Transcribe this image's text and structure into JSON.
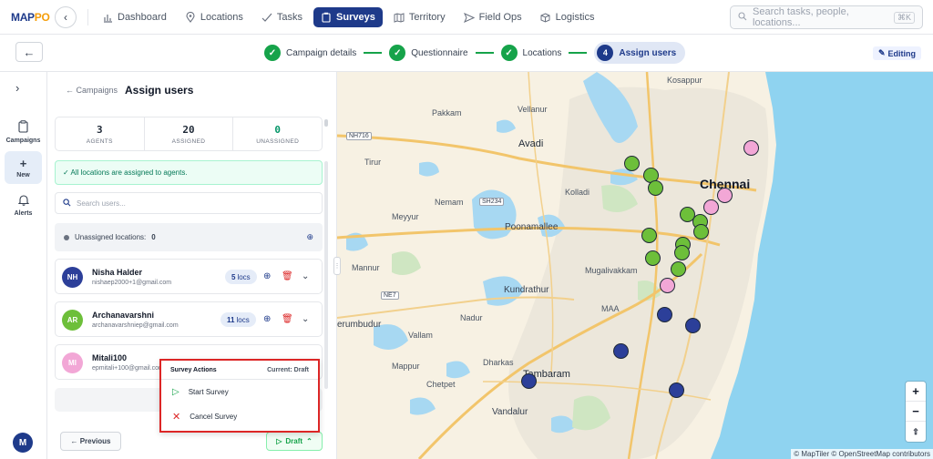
{
  "app": {
    "logo_main": "MAP",
    "logo_accent": "PO"
  },
  "nav": {
    "items": [
      {
        "label": "Dashboard",
        "icon": "bar-chart-icon"
      },
      {
        "label": "Locations",
        "icon": "pin-icon"
      },
      {
        "label": "Tasks",
        "icon": "check-icon"
      },
      {
        "label": "Surveys",
        "icon": "clipboard-icon",
        "active": true
      },
      {
        "label": "Territory",
        "icon": "map-icon"
      },
      {
        "label": "Field Ops",
        "icon": "send-icon"
      },
      {
        "label": "Logistics",
        "icon": "box-icon"
      }
    ],
    "search_placeholder": "Search tasks, people, locations...",
    "search_shortcut": "⌘K"
  },
  "stepper": {
    "steps": [
      {
        "num": "1",
        "label": "Campaign details",
        "done": true
      },
      {
        "num": "2",
        "label": "Questionnaire",
        "done": true
      },
      {
        "num": "3",
        "label": "Locations",
        "done": true
      },
      {
        "num": "4",
        "label": "Assign users",
        "done": false
      }
    ],
    "editing_label": "Editing"
  },
  "rail": {
    "items": [
      {
        "label": "Campaigns"
      },
      {
        "label": "New"
      },
      {
        "label": "Alerts"
      }
    ],
    "user_initial": "M"
  },
  "panel": {
    "crumb": "← Campaigns",
    "title": "Assign users",
    "stats": [
      {
        "value": "3",
        "label": "AGENTS"
      },
      {
        "value": "20",
        "label": "ASSIGNED"
      },
      {
        "value": "0",
        "label": "UNASSIGNED"
      }
    ],
    "alert": "✓ All locations are assigned to agents.",
    "search_placeholder": "Search users...",
    "unassigned_label": "Unassigned locations:",
    "unassigned_count": "0",
    "agents": [
      {
        "initials": "NH",
        "name": "Nisha Halder",
        "email": "nishaep2000+1@gmail.com",
        "locs_num": "5",
        "locs_unit": "locs",
        "color": "#2c3f99"
      },
      {
        "initials": "AR",
        "name": "Archanavarshni",
        "email": "archanavarshniep@gmail.com",
        "locs_num": "11",
        "locs_unit": "locs",
        "color": "#6dbf3a"
      },
      {
        "initials": "MI",
        "name": "Mitali100",
        "email": "epmitali+100@gmail.com",
        "color": "#f2a7d6"
      }
    ],
    "previous_label": "← Previous",
    "draft_label": "Draft"
  },
  "popup": {
    "title": "Survey Actions",
    "current": "Current: Draft",
    "items": [
      {
        "label": "Start Survey",
        "icon": "play-icon"
      },
      {
        "label": "Cancel Survey",
        "icon": "x-icon"
      }
    ]
  },
  "map": {
    "labels": {
      "kosappur": "Kosappur",
      "pakkam": "Pakkam",
      "vellanur": "Vellanur",
      "avadi": "Avadi",
      "tirur": "Tirur",
      "chennai": "Chennai",
      "nemam": "Nemam",
      "kolladi": "Kolladi",
      "meyyur": "Meyyur",
      "poonamallee": "Poonamallee",
      "mannur": "Mannur",
      "mugalivakkam": "Mugalivakkam",
      "kundrathur": "Kundrathur",
      "perumbudur": "erumbudur",
      "nadur": "Nadur",
      "vallam": "Vallam",
      "mappur": "Mappur",
      "dharkas": "Dharkas",
      "tambaram": "Tambaram",
      "chetpet": "Chetpet",
      "vandalur": "Vandalur",
      "maa": "MAA"
    },
    "roads": {
      "nh716": "NH716",
      "sh234": "SH234",
      "ne7": "NE7"
    },
    "attribution": "© MapTiler © OpenStreetMap contributors",
    "zoom_in": "+",
    "zoom_out": "−",
    "reset": "⇧"
  }
}
